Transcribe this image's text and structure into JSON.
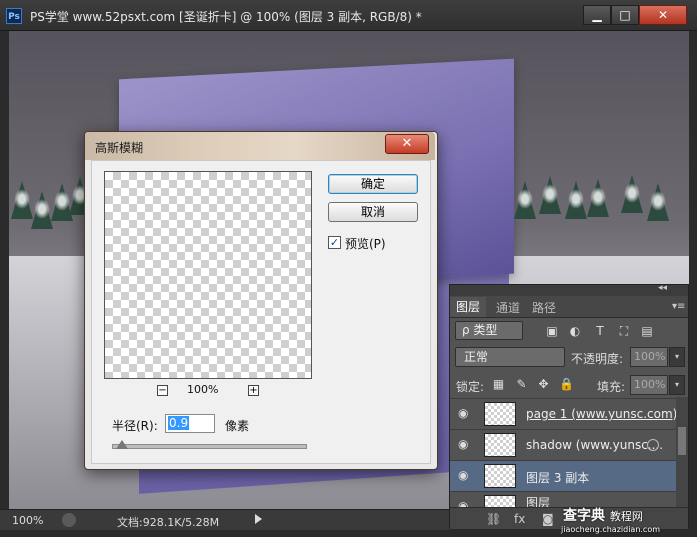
{
  "window": {
    "app_icon": "Ps",
    "title": "PS学堂 www.52psxt.com [圣诞折卡] @ 100% (图层 3 副本, RGB/8) *",
    "minimize_icon": "minimize-icon",
    "maximize_icon": "maximize-icon",
    "close_icon": "close-icon",
    "minimize_glyph": "▁",
    "maximize_glyph": "□",
    "close_glyph": "✕"
  },
  "statusbar": {
    "zoom": "100%",
    "doc_info": "文档:928.1K/5.28M"
  },
  "dialog": {
    "title": "高斯模糊",
    "close_glyph": "✕",
    "zoom_out": "−",
    "zoom_in": "+",
    "preview_zoom": "100%",
    "ok_label": "确定",
    "cancel_label": "取消",
    "preview_checked": true,
    "preview_check_glyph": "✓",
    "preview_label": "预览(P)",
    "radius_label": "半径(R):",
    "radius_value": "0.9",
    "unit_label": "像素",
    "slider_fraction": 0.05
  },
  "layers_panel": {
    "collapse_glyph": "◂◂",
    "tabs": [
      "图层",
      "通道",
      "路径"
    ],
    "menu_glyph": "▾≡",
    "filter_kind": "ρ 类型",
    "filter_icons": [
      "image-icon",
      "adjustment-icon",
      "text-icon",
      "shape-icon",
      "smart-object-icon"
    ],
    "filter_glyphs": [
      "▣",
      "◐",
      "T",
      "⛶",
      "▤"
    ],
    "blend_mode": "正常",
    "opacity_label": "不透明度:",
    "opacity_value": "100%",
    "lock_label": "锁定:",
    "lock_glyphs": [
      "▦",
      "✎",
      "✥",
      "🔒"
    ],
    "fill_label": "填充:",
    "fill_value": "100%",
    "dropdown_glyph": "▾",
    "eye_glyph": "◉",
    "layers": [
      {
        "name": "page 1 (www.yunsc.com)",
        "selected": false
      },
      {
        "name": "shadow (www.yunsc....",
        "selected": false
      },
      {
        "name": "图层 3 副本",
        "selected": true
      },
      {
        "name": "图层",
        "selected": false
      }
    ],
    "bottom_glyphs": [
      "⛓",
      "fx",
      "◙"
    ]
  },
  "watermark": {
    "brand": "查字典",
    "site": "教程网",
    "url": "jiaocheng.chazidian.com"
  },
  "colors": {
    "card_purple": "#8b82c0",
    "selected_layer": "#566a86",
    "close_red": "#c43c25"
  }
}
